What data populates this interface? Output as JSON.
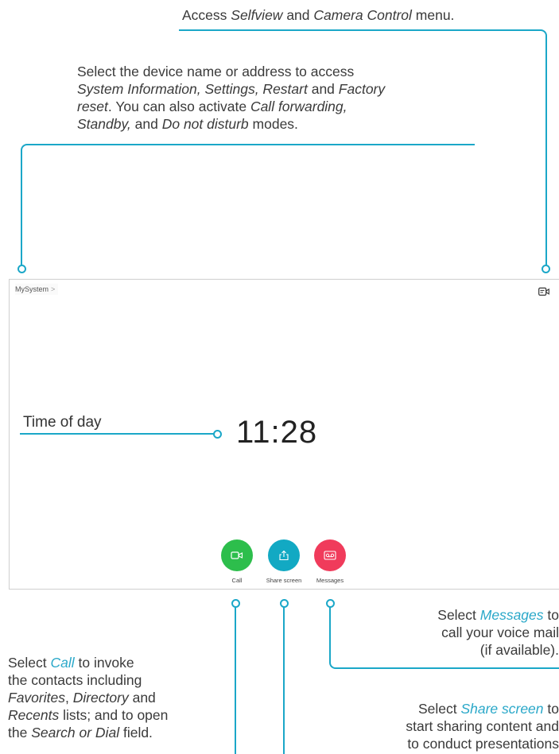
{
  "annotations": {
    "camera": [
      "Access ",
      "Selfview",
      " and ",
      "Camera Control",
      " menu."
    ],
    "device_line1": "Select the device name or address to access",
    "device_line2": [
      "System Information, Settings, Restart",
      " and ",
      "Factory"
    ],
    "device_line3": [
      "reset",
      ". You can also activate ",
      "Call forwarding,"
    ],
    "device_line4": [
      "Standby,",
      " and ",
      "Do not disturb",
      " modes."
    ],
    "time_of_day": "Time of day",
    "messages_line1": [
      "Select ",
      "Messages",
      " to"
    ],
    "messages_line2": "call your voice mail",
    "messages_line3": "(if available).",
    "call_line1": [
      "Select ",
      "Call",
      " to invoke"
    ],
    "call_line2": "the contacts including",
    "call_line3": [
      "Favorites",
      ", ",
      "Directory",
      " and"
    ],
    "call_line4": [
      "Recents",
      " lists; and to open"
    ],
    "call_line5": [
      "the ",
      "Search or Dial",
      " field."
    ],
    "share_line1": [
      "Select ",
      "Share screen",
      " to"
    ],
    "share_line2": "start sharing content and",
    "share_line3": "to conduct presentations"
  },
  "screen": {
    "system_name": "MySystem",
    "chevron": ">",
    "clock": "11:28",
    "buttons": [
      {
        "label": "Call",
        "color": "#2dbe4c",
        "icon": "video-camera-icon"
      },
      {
        "label": "Share screen",
        "color": "#12a9c3",
        "icon": "share-screen-icon"
      },
      {
        "label": "Messages",
        "color": "#f03b5b",
        "icon": "voicemail-icon"
      }
    ]
  },
  "colors": {
    "accent_line": "#1ba7c8",
    "highlight_text": "#2aa8c9"
  }
}
